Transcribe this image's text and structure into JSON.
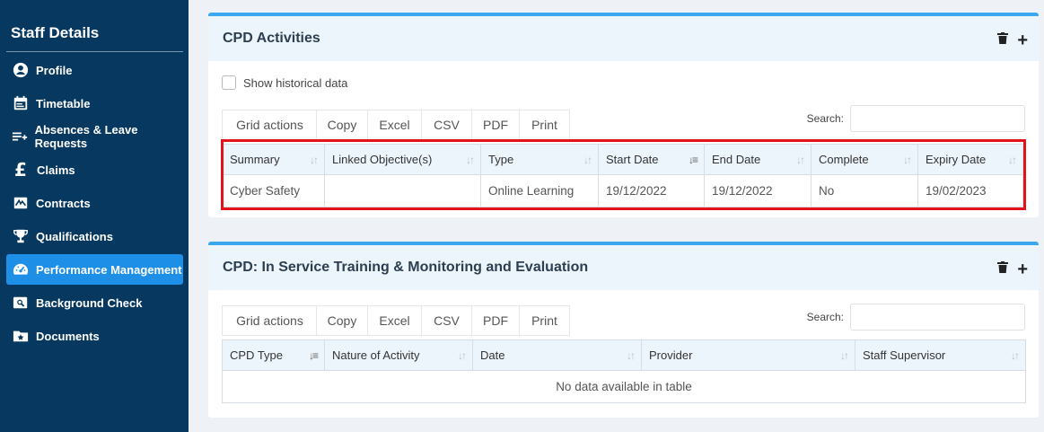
{
  "sidebar": {
    "title": "Staff Details",
    "items": [
      {
        "label": "Profile",
        "icon": "user-circle-icon"
      },
      {
        "label": "Timetable",
        "icon": "calendar-icon"
      },
      {
        "label": "Absences & Leave Requests",
        "icon": "list-plus-icon"
      },
      {
        "label": "Claims",
        "icon": "pound-icon"
      },
      {
        "label": "Contracts",
        "icon": "signature-icon"
      },
      {
        "label": "Qualifications",
        "icon": "trophy-icon"
      },
      {
        "label": "Performance Management",
        "icon": "gauge-icon",
        "active": true
      },
      {
        "label": "Background Check",
        "icon": "search-id-icon"
      },
      {
        "label": "Documents",
        "icon": "folder-star-icon"
      }
    ]
  },
  "pound_glyph": "£",
  "cpd": {
    "title": "CPD Activities",
    "historical_label": "Show historical data",
    "grid_actions_label": "Grid actions",
    "actions": [
      "Copy",
      "Excel",
      "CSV",
      "PDF",
      "Print"
    ],
    "search_label": "Search:",
    "columns": [
      "Summary",
      "Linked Objective(s)",
      "Type",
      "Start Date",
      "End Date",
      "Complete",
      "Expiry Date"
    ],
    "rows": [
      [
        "Cyber Safety",
        "",
        "Online Learning",
        "19/12/2022",
        "19/12/2022",
        "No",
        "19/02/2023"
      ]
    ]
  },
  "inservice": {
    "title": "CPD: In Service Training & Monitoring and Evaluation",
    "grid_actions_label": "Grid actions",
    "actions": [
      "Copy",
      "Excel",
      "CSV",
      "PDF",
      "Print"
    ],
    "search_label": "Search:",
    "columns": [
      "CPD Type",
      "Nature of Activity",
      "Date",
      "Provider",
      "Staff Supervisor"
    ],
    "empty_message": "No data available in table"
  },
  "colors": {
    "sidebar_bg": "#07385f",
    "active_item": "#1e8fe6",
    "panel_accent": "#3ba7ef",
    "highlight": "#e3121b"
  }
}
